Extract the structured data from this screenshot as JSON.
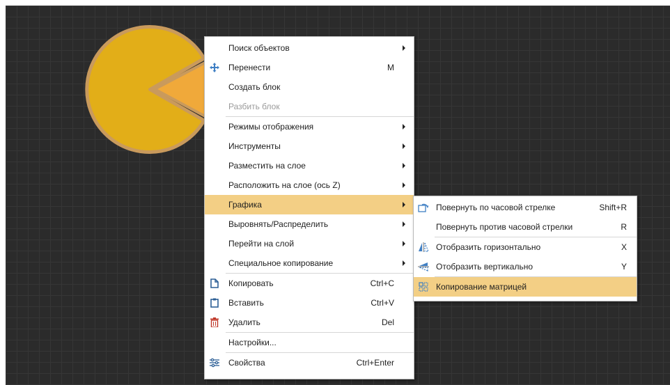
{
  "colors": {
    "canvas": "#2b2b2b",
    "pie_fill": "#e2ae18",
    "pie_border": "#c99a5c",
    "pie_slice": "#f0a93a",
    "highlight": "#f3cf85"
  },
  "context_menu": {
    "items": [
      {
        "label": "Поиск объектов",
        "shortcut": "",
        "submenu": true,
        "icon": ""
      },
      {
        "label": "Перенести",
        "shortcut": "M",
        "submenu": false,
        "icon": "move-icon"
      },
      {
        "label": "Создать блок",
        "shortcut": "",
        "submenu": false,
        "icon": ""
      },
      {
        "label": "Разбить блок",
        "shortcut": "",
        "submenu": false,
        "icon": "",
        "disabled": true
      },
      {
        "label": "Режимы отображения",
        "shortcut": "",
        "submenu": true,
        "icon": ""
      },
      {
        "label": "Инструменты",
        "shortcut": "",
        "submenu": true,
        "icon": ""
      },
      {
        "label": "Разместить на слое",
        "shortcut": "",
        "submenu": true,
        "icon": ""
      },
      {
        "label": "Расположить на слое (ось Z)",
        "shortcut": "",
        "submenu": true,
        "icon": ""
      },
      {
        "label": "Графика",
        "shortcut": "",
        "submenu": true,
        "icon": "",
        "highlighted": true
      },
      {
        "label": "Выровнять/Распределить",
        "shortcut": "",
        "submenu": true,
        "icon": ""
      },
      {
        "label": "Перейти на слой",
        "shortcut": "",
        "submenu": true,
        "icon": ""
      },
      {
        "label": "Специальное копирование",
        "shortcut": "",
        "submenu": true,
        "icon": ""
      },
      {
        "label": "Копировать",
        "shortcut": "Ctrl+C",
        "submenu": false,
        "icon": "copy-icon"
      },
      {
        "label": "Вставить",
        "shortcut": "Ctrl+V",
        "submenu": false,
        "icon": "paste-icon"
      },
      {
        "label": "Удалить",
        "shortcut": "Del",
        "submenu": false,
        "icon": "trash-icon"
      },
      {
        "label": "Настройки...",
        "shortcut": "",
        "submenu": false,
        "icon": ""
      },
      {
        "label": "Свойства",
        "shortcut": "Ctrl+Enter",
        "submenu": false,
        "icon": "properties-icon"
      }
    ]
  },
  "graphics_submenu": {
    "items": [
      {
        "label": "Повернуть по часовой стрелке",
        "shortcut": "Shift+R",
        "icon": "rotate-clockwise-icon"
      },
      {
        "label": "Повернуть против часовой стрелки",
        "shortcut": "R",
        "icon": ""
      },
      {
        "label": "Отобразить горизонтально",
        "shortcut": "X",
        "icon": "flip-horizontal-icon"
      },
      {
        "label": "Отобразить вертикально",
        "shortcut": "Y",
        "icon": "flip-vertical-icon"
      },
      {
        "label": "Копирование матрицей",
        "shortcut": "",
        "icon": "array-copy-icon",
        "highlighted": true
      }
    ]
  }
}
